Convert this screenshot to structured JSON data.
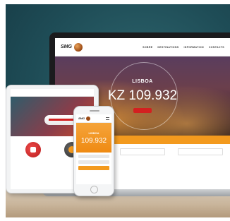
{
  "laptop": {
    "logo_text": "SMG",
    "nav": [
      "SOBRE",
      "DESTINATIONS",
      "INFORMATION",
      "CONTACTS"
    ],
    "hero_city": "LISBOA",
    "hero_price": "KZ 109.932",
    "colors": {
      "accent": "#f39a1e",
      "cta": "#d32020"
    }
  },
  "phone": {
    "logo_text": "SMG",
    "hero_city": "LISBOA",
    "hero_price": "109.932"
  }
}
